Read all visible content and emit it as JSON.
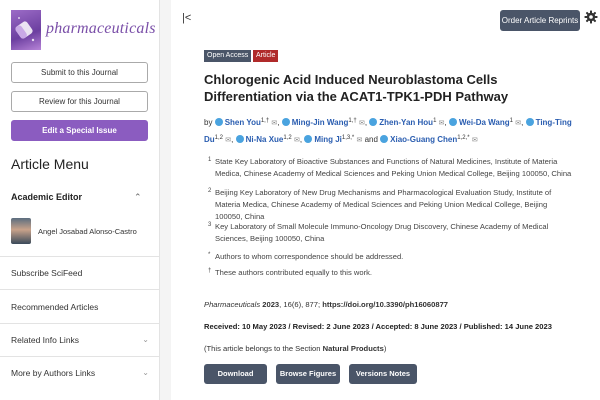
{
  "brand": {
    "name": "pharmaceuticals",
    "color": "#7a4fa8"
  },
  "sidebar": {
    "submit_label": "Submit to this Journal",
    "review_label": "Review for this Journal",
    "special_issue_label": "Edit a Special Issue",
    "menu_title": "Article Menu",
    "editor_heading": "Academic Editor",
    "editor_name": "Angel Josabad Alonso-Castro",
    "links": [
      {
        "label": "Subscribe SciFeed",
        "chevron": false
      },
      {
        "label": "Recommended Articles",
        "chevron": false
      },
      {
        "label": "Related Info Links",
        "chevron": true
      },
      {
        "label": "More by Authors Links",
        "chevron": true
      }
    ]
  },
  "header": {
    "collapse_icon": "collapse-left-icon",
    "reprints_label": "Order Article Reprints",
    "settings_icon": "gear-icon"
  },
  "article": {
    "badges": {
      "open_access": "Open Access",
      "type": "Article"
    },
    "title": "Chlorogenic Acid Induced Neuroblastoma Cells Differentiation via the ACAT1-TPK1-PDH Pathway",
    "by": "by",
    "and": "and",
    "authors": [
      {
        "name": "Shen You",
        "sup": "1,†"
      },
      {
        "name": "Ming-Jin Wang",
        "sup": "1,†"
      },
      {
        "name": "Zhen-Yan Hou",
        "sup": "1"
      },
      {
        "name": "Wei-Da Wang",
        "sup": "1"
      },
      {
        "name": "Ting-Ting Du",
        "sup": "1,2"
      },
      {
        "name": "Ni-Na Xue",
        "sup": "1,2"
      },
      {
        "name": "Ming Ji",
        "sup": "1,3,*"
      },
      {
        "name": "Xiao-Guang Chen",
        "sup": "1,2,*"
      }
    ],
    "affiliations": [
      {
        "num": "1",
        "text": "State Key Laboratory of Bioactive Substances and Functions of Natural Medicines, Institute of Materia Medica, Chinese Academy of Medical Sciences and Peking Union Medical College, Beijing 100050, China"
      },
      {
        "num": "2",
        "text": "Beijing Key Laboratory of New Drug Mechanisms and Pharmacological Evaluation Study, Institute of Materia Medica, Chinese Academy of Medical Sciences and Peking Union Medical College, Beijing 100050, China"
      },
      {
        "num": "3",
        "text": "Key Laboratory of Small Molecule Immuno-Oncology Drug Discovery, Chinese Academy of Medical Sciences, Beijing 100050, China"
      },
      {
        "num": "*",
        "text": "Authors to whom correspondence should be addressed."
      },
      {
        "num": "†",
        "text": "These authors contributed equally to this work."
      }
    ],
    "citation": {
      "journal": "Pharmaceuticals",
      "year": "2023",
      "volume_pages": ", 16(6), 877;",
      "doi": "https://doi.org/10.3390/ph16060877"
    },
    "dates": "Received: 10 May 2023 / Revised: 2 June 2023 / Accepted: 8 June 2023 / Published: 14 June 2023",
    "section_prefix": "(This article belongs to the Section",
    "section_name": "Natural Products",
    "section_suffix": ")"
  },
  "actions": {
    "download": "Download",
    "browse_figures": "Browse Figures",
    "versions_notes": "Versions Notes"
  },
  "colors": {
    "accent_purple": "#8b5cc0",
    "button_slate": "#4a5568",
    "article_badge_red": "#b02a2a",
    "author_blue": "#2a5db0",
    "orcid_icon_blue": "#4aa3df"
  }
}
